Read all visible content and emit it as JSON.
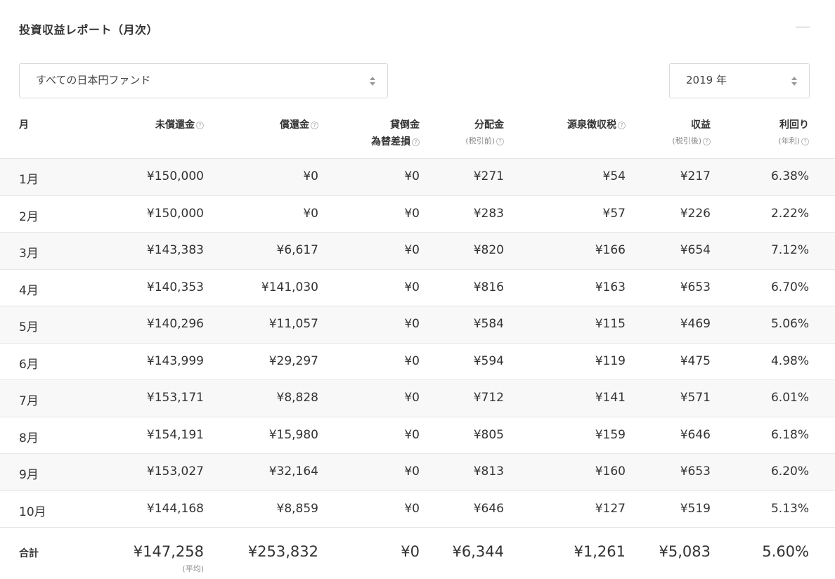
{
  "page_title": "投資収益レポート（月次）",
  "fund_select": {
    "value": "すべての日本円ファンド"
  },
  "year_select": {
    "value": "2019 年"
  },
  "headers": [
    {
      "line1": "月"
    },
    {
      "line1": "未償還金",
      "help": "?"
    },
    {
      "line1": "償還金",
      "help": "?"
    },
    {
      "line1": "貸倒金",
      "line2": "為替差損",
      "help": "?"
    },
    {
      "line1": "分配金",
      "line2": "(税引前)",
      "help": "?"
    },
    {
      "line1": "源泉徴収税",
      "help": "?"
    },
    {
      "line1": "収益",
      "line2": "(税引後)",
      "help": "?"
    },
    {
      "line1": "利回り",
      "line2": "(年利)",
      "help": "?"
    }
  ],
  "rows": [
    {
      "month": "1月",
      "unredeemed": "¥150,000",
      "redeemed": "¥0",
      "loss": "¥0",
      "dividend": "¥271",
      "tax": "¥54",
      "profit": "¥217",
      "yield": "6.38%"
    },
    {
      "month": "2月",
      "unredeemed": "¥150,000",
      "redeemed": "¥0",
      "loss": "¥0",
      "dividend": "¥283",
      "tax": "¥57",
      "profit": "¥226",
      "yield": "2.22%"
    },
    {
      "month": "3月",
      "unredeemed": "¥143,383",
      "redeemed": "¥6,617",
      "loss": "¥0",
      "dividend": "¥820",
      "tax": "¥166",
      "profit": "¥654",
      "yield": "7.12%"
    },
    {
      "month": "4月",
      "unredeemed": "¥140,353",
      "redeemed": "¥141,030",
      "loss": "¥0",
      "dividend": "¥816",
      "tax": "¥163",
      "profit": "¥653",
      "yield": "6.70%"
    },
    {
      "month": "5月",
      "unredeemed": "¥140,296",
      "redeemed": "¥11,057",
      "loss": "¥0",
      "dividend": "¥584",
      "tax": "¥115",
      "profit": "¥469",
      "yield": "5.06%"
    },
    {
      "month": "6月",
      "unredeemed": "¥143,999",
      "redeemed": "¥29,297",
      "loss": "¥0",
      "dividend": "¥594",
      "tax": "¥119",
      "profit": "¥475",
      "yield": "4.98%"
    },
    {
      "month": "7月",
      "unredeemed": "¥153,171",
      "redeemed": "¥8,828",
      "loss": "¥0",
      "dividend": "¥712",
      "tax": "¥141",
      "profit": "¥571",
      "yield": "6.01%"
    },
    {
      "month": "8月",
      "unredeemed": "¥154,191",
      "redeemed": "¥15,980",
      "loss": "¥0",
      "dividend": "¥805",
      "tax": "¥159",
      "profit": "¥646",
      "yield": "6.18%"
    },
    {
      "month": "9月",
      "unredeemed": "¥153,027",
      "redeemed": "¥32,164",
      "loss": "¥0",
      "dividend": "¥813",
      "tax": "¥160",
      "profit": "¥653",
      "yield": "6.20%"
    },
    {
      "month": "10月",
      "unredeemed": "¥144,168",
      "redeemed": "¥8,859",
      "loss": "¥0",
      "dividend": "¥646",
      "tax": "¥127",
      "profit": "¥519",
      "yield": "5.13%"
    }
  ],
  "totals": {
    "label": "合計",
    "unredeemed": "¥147,258",
    "unredeemed_note": "(平均)",
    "redeemed": "¥253,832",
    "loss": "¥0",
    "dividend": "¥6,344",
    "tax": "¥1,261",
    "profit": "¥5,083",
    "yield": "5.60%"
  }
}
